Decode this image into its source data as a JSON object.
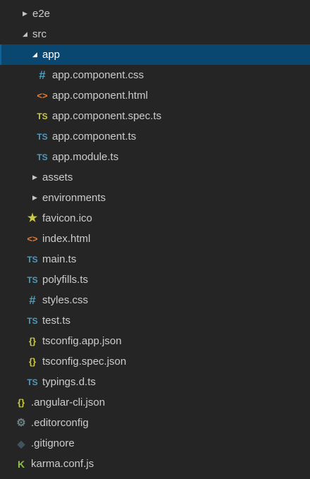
{
  "tree": [
    {
      "label": "e2e",
      "twisty": "▶",
      "icon": "",
      "icon_class": "",
      "indent": 32,
      "selected": false,
      "kind": "folder-e2e"
    },
    {
      "label": "src",
      "twisty": "◢",
      "icon": "",
      "icon_class": "",
      "indent": 32,
      "selected": false,
      "kind": "folder-src"
    },
    {
      "label": "app",
      "twisty": "◢",
      "icon": "",
      "icon_class": "",
      "indent": 46,
      "selected": true,
      "kind": "folder-app"
    },
    {
      "label": "app.component.css",
      "twisty": "",
      "icon": "#",
      "icon_class": "css-icon",
      "icon_name": "css-file-icon",
      "indent": 50,
      "selected": false,
      "kind": "file-app-component-css"
    },
    {
      "label": "app.component.html",
      "twisty": "",
      "icon": "<>",
      "icon_class": "html-icon",
      "icon_name": "html-file-icon",
      "indent": 50,
      "selected": false,
      "kind": "file-app-component-html"
    },
    {
      "label": "app.component.spec.ts",
      "twisty": "",
      "icon": "TS",
      "icon_class": "spec-icon",
      "icon_name": "typescript-spec-file-icon",
      "indent": 50,
      "selected": false,
      "kind": "file-app-component-spec-ts"
    },
    {
      "label": "app.component.ts",
      "twisty": "",
      "icon": "TS",
      "icon_class": "ts-icon",
      "icon_name": "typescript-file-icon",
      "indent": 50,
      "selected": false,
      "kind": "file-app-component-ts"
    },
    {
      "label": "app.module.ts",
      "twisty": "",
      "icon": "TS",
      "icon_class": "ts-icon",
      "icon_name": "typescript-file-icon",
      "indent": 50,
      "selected": false,
      "kind": "file-app-module-ts"
    },
    {
      "label": "assets",
      "twisty": "▶",
      "icon": "",
      "icon_class": "",
      "indent": 46,
      "selected": false,
      "kind": "folder-assets"
    },
    {
      "label": "environments",
      "twisty": "▶",
      "icon": "",
      "icon_class": "",
      "indent": 46,
      "selected": false,
      "kind": "folder-environments"
    },
    {
      "label": "favicon.ico",
      "twisty": "",
      "icon": "★",
      "icon_class": "star-icon",
      "icon_name": "star-icon",
      "indent": 36,
      "selected": false,
      "kind": "file-favicon-ico"
    },
    {
      "label": "index.html",
      "twisty": "",
      "icon": "<>",
      "icon_class": "html-icon",
      "icon_name": "html-file-icon",
      "indent": 36,
      "selected": false,
      "kind": "file-index-html"
    },
    {
      "label": "main.ts",
      "twisty": "",
      "icon": "TS",
      "icon_class": "ts-icon",
      "icon_name": "typescript-file-icon",
      "indent": 36,
      "selected": false,
      "kind": "file-main-ts"
    },
    {
      "label": "polyfills.ts",
      "twisty": "",
      "icon": "TS",
      "icon_class": "ts-icon",
      "icon_name": "typescript-file-icon",
      "indent": 36,
      "selected": false,
      "kind": "file-polyfills-ts"
    },
    {
      "label": "styles.css",
      "twisty": "",
      "icon": "#",
      "icon_class": "css-icon",
      "icon_name": "css-file-icon",
      "indent": 36,
      "selected": false,
      "kind": "file-styles-css"
    },
    {
      "label": "test.ts",
      "twisty": "",
      "icon": "TS",
      "icon_class": "ts-icon",
      "icon_name": "typescript-file-icon",
      "indent": 36,
      "selected": false,
      "kind": "file-test-ts"
    },
    {
      "label": "tsconfig.app.json",
      "twisty": "",
      "icon": "{}",
      "icon_class": "json-icon",
      "icon_name": "json-file-icon",
      "indent": 36,
      "selected": false,
      "kind": "file-tsconfig-app-json"
    },
    {
      "label": "tsconfig.spec.json",
      "twisty": "",
      "icon": "{}",
      "icon_class": "json-icon",
      "icon_name": "json-file-icon",
      "indent": 36,
      "selected": false,
      "kind": "file-tsconfig-spec-json"
    },
    {
      "label": "typings.d.ts",
      "twisty": "",
      "icon": "TS",
      "icon_class": "ts-icon",
      "icon_name": "typescript-file-icon",
      "indent": 36,
      "selected": false,
      "kind": "file-typings-d-ts"
    },
    {
      "label": ".angular-cli.json",
      "twisty": "",
      "icon": "{}",
      "icon_class": "json-icon",
      "icon_name": "json-file-icon",
      "indent": 20,
      "selected": false,
      "kind": "file-angular-cli-json"
    },
    {
      "label": ".editorconfig",
      "twisty": "",
      "icon": "⚙",
      "icon_class": "gear-icon",
      "icon_name": "gear-icon",
      "indent": 20,
      "selected": false,
      "kind": "file-editorconfig"
    },
    {
      "label": ".gitignore",
      "twisty": "",
      "icon": "◆",
      "icon_class": "diamond-icon",
      "icon_name": "git-diamond-icon",
      "indent": 20,
      "selected": false,
      "kind": "file-gitignore"
    },
    {
      "label": "karma.conf.js",
      "twisty": "",
      "icon": "K",
      "icon_class": "karma-icon",
      "icon_name": "karma-icon",
      "indent": 20,
      "selected": false,
      "kind": "file-karma-conf-js"
    }
  ]
}
